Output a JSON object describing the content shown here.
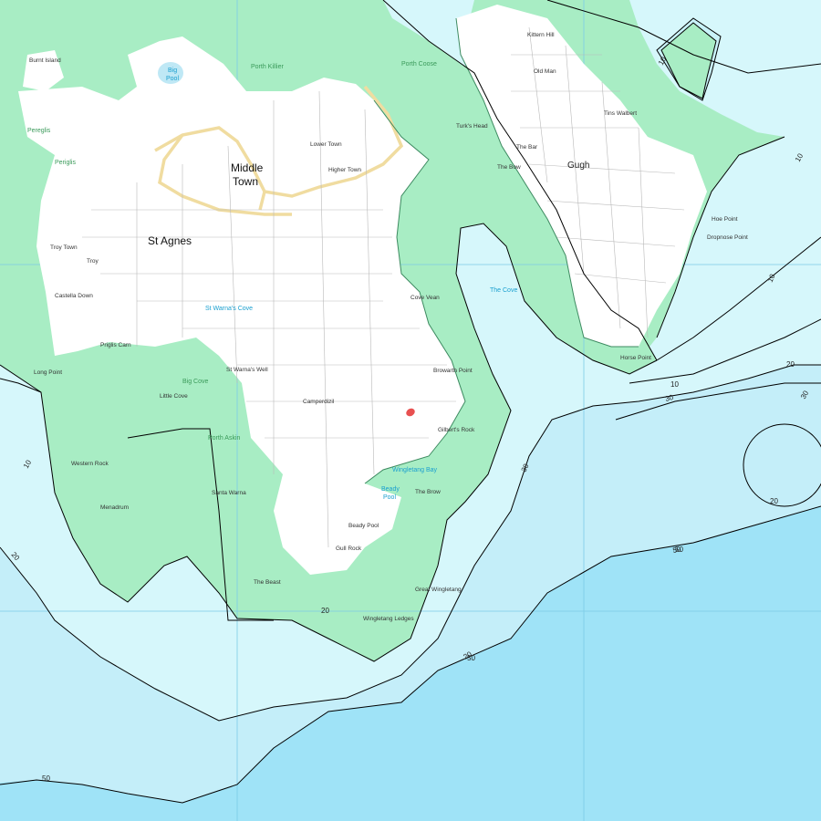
{
  "map": {
    "colors": {
      "deep_sea": "#9fe3f7",
      "mid_sea": "#c4eef9",
      "shallow_sea": "#d6f7fb",
      "intertidal": "#a8edc4",
      "land": "#ffffff",
      "grid": "#7ccbe6",
      "contour": "#000000",
      "marker": "#e85050"
    },
    "places": {
      "st_agnes": "St Agnes",
      "middle_town_1": "Middle",
      "middle_town_2": "Town",
      "gugh": "Gugh",
      "big_pool": "Big",
      "big_pool_2": "Pool",
      "troy_town": "Troy Town",
      "the_bar": "The Bar",
      "the_cove": "The Cove",
      "the_bow": "The Bow",
      "periglis": "Periglis",
      "wingletang_bay": "Wingletang Bay",
      "beady_pool": "Beady",
      "beady_pool_2": "Pool",
      "gilberts_rock": "Gilbert's Rock",
      "browarth_point": "Browarth Point",
      "cove_vean": "Cove Vean",
      "camperdizil": "Camperdizil",
      "lower_town": "Lower Town",
      "higher_town": "Higher Town",
      "turks_head": "Turk's Head",
      "st_warna_cove": "St Warna's Cove",
      "the_brow": "The Brow",
      "the_gull_rock": "Gull Rock",
      "western_rocks": "Western Rock",
      "kittern_hill": "Kittern Hill",
      "dropnose_point": "Dropnose Point",
      "hoe_point": "Hoe Point",
      "tins_walbert": "Tins Walbert",
      "old_man": "Old Man",
      "the_beast": "The Beast",
      "wingletang_ledges": "Wingletang Ledges",
      "great_wingletang": "Great Wingletang",
      "castella_down": "Castella Down",
      "little_cove": "Little Cove",
      "long_point": "Long Point",
      "burnt_island": "Burnt Island",
      "big_cove": "Big Cove",
      "santa_warna": "Santa Warna",
      "porth_killier": "Porth Killier",
      "porth_askin": "Porth Askin",
      "porth_coose": "Porth Coose",
      "st_warnas_well": "St Warna's Well",
      "tolls_island": "Troy",
      "annet_beady": "Beady Pool",
      "menadrum": "Menadrum",
      "priglis_cove": "Priglis Carn",
      "horse_point": "Horse Point",
      "pereglis": "Pereglis"
    },
    "depth_labels": [
      "10",
      "20",
      "30",
      "50",
      "20",
      "30",
      "10",
      "10",
      "20",
      "50",
      "10",
      "30",
      "20",
      "20",
      "50",
      "50",
      "10"
    ]
  }
}
